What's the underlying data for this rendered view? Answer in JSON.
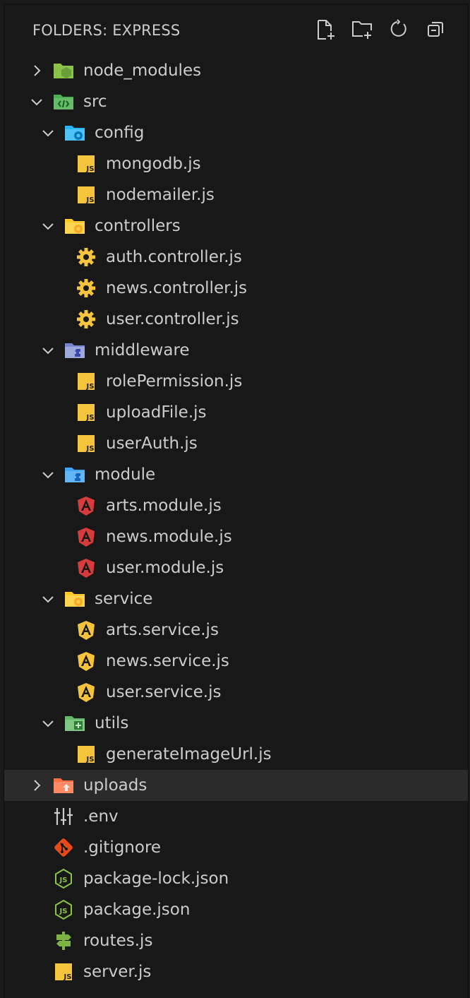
{
  "header": {
    "title": "FOLDERS: EXPRESS",
    "actions": [
      {
        "name": "new-file",
        "icon": "new-file-icon"
      },
      {
        "name": "new-folder",
        "icon": "new-folder-icon"
      },
      {
        "name": "refresh",
        "icon": "refresh-icon"
      },
      {
        "name": "collapse-all",
        "icon": "collapse-all-icon"
      }
    ]
  },
  "tree": [
    {
      "label": "node_modules",
      "depth": 0,
      "type": "folder",
      "expanded": false,
      "icon": "node-folder-icon"
    },
    {
      "label": "src",
      "depth": 0,
      "type": "folder",
      "expanded": true,
      "icon": "src-folder-icon"
    },
    {
      "label": "config",
      "depth": 1,
      "type": "folder",
      "expanded": true,
      "icon": "config-folder-icon"
    },
    {
      "label": "mongodb.js",
      "depth": 2,
      "type": "file",
      "icon": "js-icon"
    },
    {
      "label": "nodemailer.js",
      "depth": 2,
      "type": "file",
      "icon": "js-icon"
    },
    {
      "label": "controllers",
      "depth": 1,
      "type": "folder",
      "expanded": true,
      "icon": "controllers-folder-icon"
    },
    {
      "label": "auth.controller.js",
      "depth": 2,
      "type": "file",
      "icon": "gear-icon"
    },
    {
      "label": "news.controller.js",
      "depth": 2,
      "type": "file",
      "icon": "gear-icon"
    },
    {
      "label": "user.controller.js",
      "depth": 2,
      "type": "file",
      "icon": "gear-icon"
    },
    {
      "label": "middleware",
      "depth": 1,
      "type": "folder",
      "expanded": true,
      "icon": "middleware-folder-icon"
    },
    {
      "label": "rolePermission.js",
      "depth": 2,
      "type": "file",
      "icon": "js-icon"
    },
    {
      "label": "uploadFile.js",
      "depth": 2,
      "type": "file",
      "icon": "js-icon"
    },
    {
      "label": "userAuth.js",
      "depth": 2,
      "type": "file",
      "icon": "js-icon"
    },
    {
      "label": "module",
      "depth": 1,
      "type": "folder",
      "expanded": true,
      "icon": "module-folder-icon"
    },
    {
      "label": "arts.module.js",
      "depth": 2,
      "type": "file",
      "icon": "angular-module-icon"
    },
    {
      "label": "news.module.js",
      "depth": 2,
      "type": "file",
      "icon": "angular-module-icon"
    },
    {
      "label": "user.module.js",
      "depth": 2,
      "type": "file",
      "icon": "angular-module-icon"
    },
    {
      "label": "service",
      "depth": 1,
      "type": "folder",
      "expanded": true,
      "icon": "service-folder-icon"
    },
    {
      "label": "arts.service.js",
      "depth": 2,
      "type": "file",
      "icon": "angular-service-icon"
    },
    {
      "label": "news.service.js",
      "depth": 2,
      "type": "file",
      "icon": "angular-service-icon"
    },
    {
      "label": "user.service.js",
      "depth": 2,
      "type": "file",
      "icon": "angular-service-icon"
    },
    {
      "label": "utils",
      "depth": 1,
      "type": "folder",
      "expanded": true,
      "icon": "utils-folder-icon"
    },
    {
      "label": "generateImageUrl.js",
      "depth": 2,
      "type": "file",
      "icon": "js-icon"
    },
    {
      "label": "uploads",
      "depth": 0,
      "type": "folder",
      "expanded": false,
      "icon": "uploads-folder-icon",
      "selected": true
    },
    {
      "label": ".env",
      "depth": 0,
      "type": "file",
      "icon": "env-icon"
    },
    {
      "label": ".gitignore",
      "depth": 0,
      "type": "file",
      "icon": "git-icon"
    },
    {
      "label": "package-lock.json",
      "depth": 0,
      "type": "file",
      "icon": "npm-package-icon"
    },
    {
      "label": "package.json",
      "depth": 0,
      "type": "file",
      "icon": "npm-package-icon"
    },
    {
      "label": "routes.js",
      "depth": 0,
      "type": "file",
      "icon": "routes-icon"
    },
    {
      "label": "server.js",
      "depth": 0,
      "type": "file",
      "icon": "js-icon"
    }
  ],
  "colors": {
    "background": "#181818",
    "text": "#cccccc",
    "selected": "#2b2b2b",
    "js": "#f5c33c",
    "angular": "#d63c3c"
  }
}
